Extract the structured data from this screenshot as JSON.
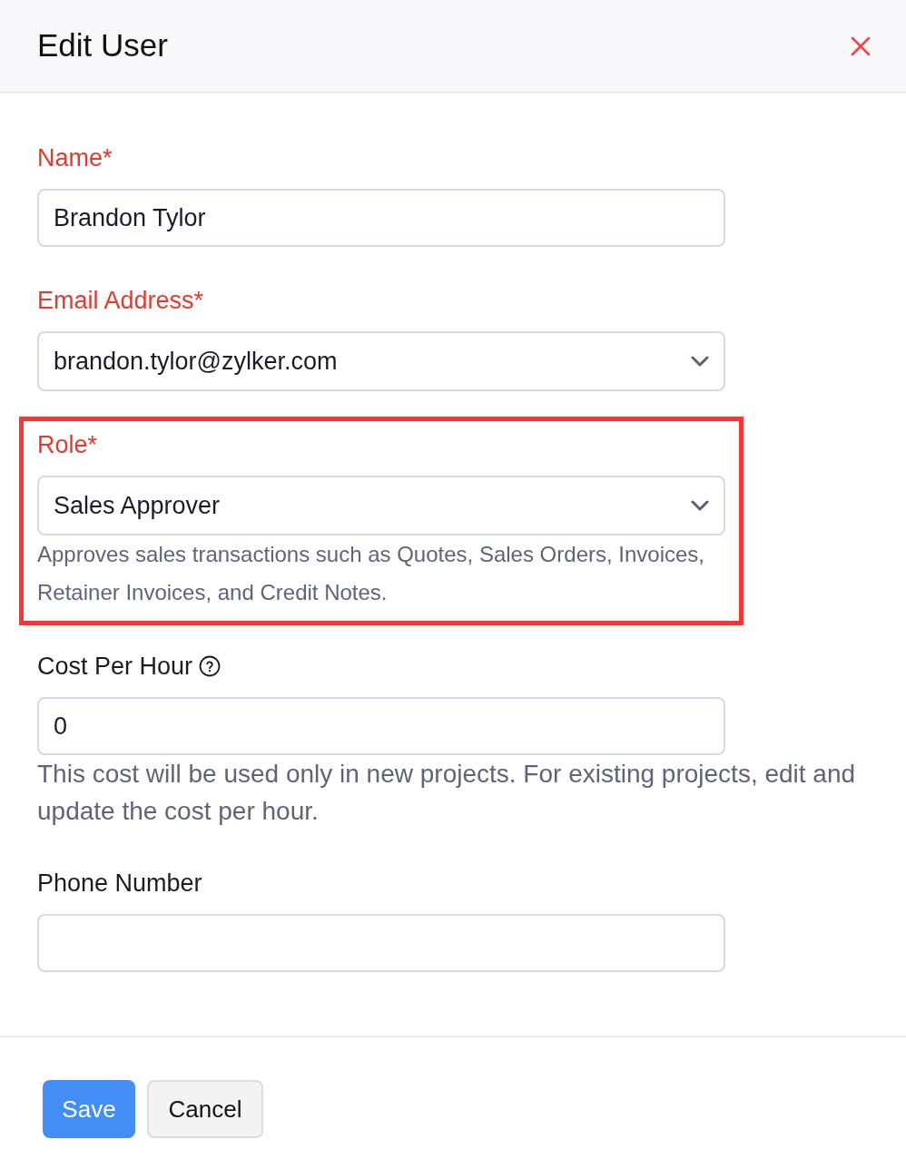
{
  "dialog": {
    "title": "Edit User"
  },
  "fields": [
    {
      "kind": "text",
      "label": "Name*",
      "required": true,
      "value": "Brandon Tylor"
    },
    {
      "kind": "select",
      "label": "Email Address*",
      "required": true,
      "value": "brandon.tylor@zylker.com"
    },
    {
      "kind": "select",
      "label": "Role*",
      "required": true,
      "value": "Sales Approver",
      "hint": "Approves sales transactions such as Quotes, Sales Orders, Invoices, Retainer Invoices, and Credit Notes.",
      "highlighted": true
    },
    {
      "kind": "text",
      "label": "Cost Per Hour",
      "required": false,
      "info_icon": true,
      "value": "0",
      "hint": "This cost will be used only in new projects. For existing projects, edit and update the cost per hour."
    },
    {
      "kind": "text",
      "label": "Phone Number",
      "required": false
    }
  ],
  "buttons": [
    {
      "kind": "primary",
      "label": "Save"
    },
    {
      "kind": "secondary",
      "label": "Cancel"
    }
  ]
}
